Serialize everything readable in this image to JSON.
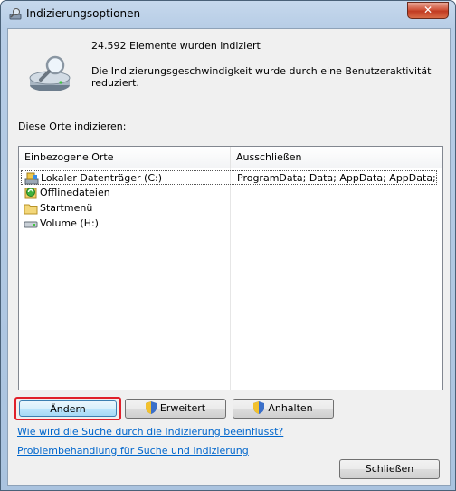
{
  "window": {
    "title": "Indizierungsoptionen",
    "close_label": "✕"
  },
  "status": {
    "count_text": "24.592 Elemente wurden indiziert",
    "speed_text": "Die Indizierungsgeschwindigkeit wurde durch eine Benutzeraktivität reduziert."
  },
  "locations_label": "Diese Orte indizieren:",
  "table": {
    "columns": [
      "Einbezogene Orte",
      "Ausschließen"
    ],
    "rows": [
      {
        "name": "Lokaler Datenträger (C:)",
        "exclude": "ProgramData; Data; AppData; AppData; ...",
        "icon": "local-drive-icon"
      },
      {
        "name": "Offlinedateien",
        "exclude": "",
        "icon": "offline-files-icon"
      },
      {
        "name": "Startmenü",
        "exclude": "",
        "icon": "folder-icon"
      },
      {
        "name": "Volume (H:)",
        "exclude": "",
        "icon": "drive-icon"
      }
    ]
  },
  "buttons": {
    "change": "Ändern",
    "advanced": "Erweitert",
    "pause": "Anhalten",
    "close": "Schließen"
  },
  "links": {
    "search_influence": "Wie wird die Suche durch die Indizierung beeinflusst?",
    "troubleshoot": "Problembehandlung für Suche und Indizierung"
  },
  "colors": {
    "link": "#0066cc",
    "highlight_border": "#e0202a"
  }
}
